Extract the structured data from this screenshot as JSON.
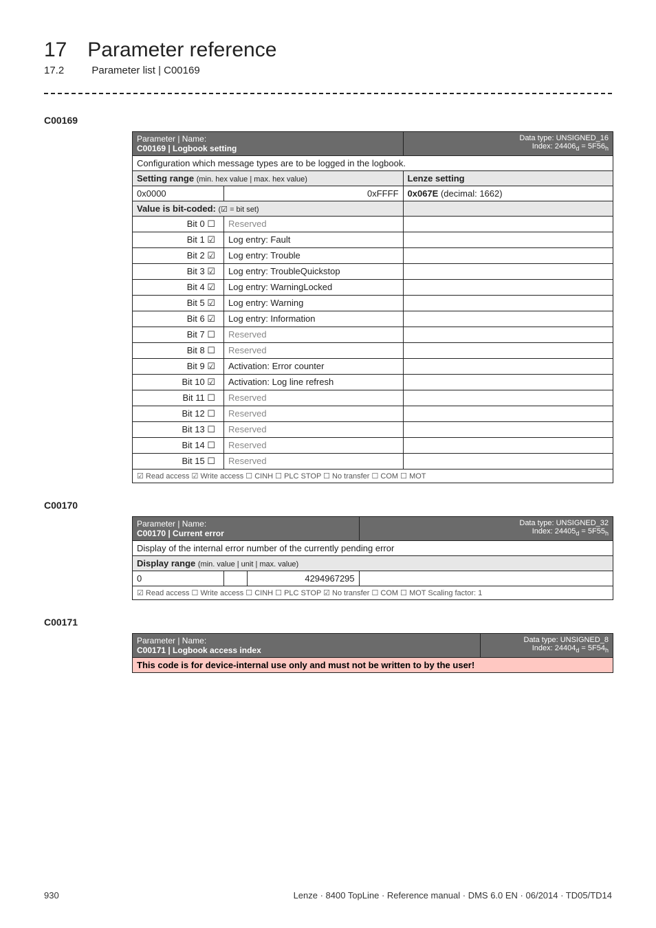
{
  "header": {
    "chapter_num": "17",
    "chapter_title": "Parameter reference",
    "section_num": "17.2",
    "section_title": "Parameter list | C00169"
  },
  "c00169": {
    "id": "C00169",
    "param_label": "Parameter | Name:",
    "name": "C00169 | Logbook setting",
    "dtype": "Data type: UNSIGNED_16",
    "index": "Index: 24406d = 5F56h",
    "config_desc": "Configuration which message types are to be logged in the logbook.",
    "setting_range_label": "Setting range",
    "setting_range_sub": "(min. hex value | max. hex value)",
    "lenze_label": "Lenze setting",
    "min": "0x0000",
    "max": "0xFFFF",
    "lenze_value": "0x067E",
    "lenze_decimal": "(decimal: 1662)",
    "bitset_label": "Value is bit-coded:",
    "bitset_sub": "(☑ = bit set)",
    "bits": [
      {
        "label": "Bit 0",
        "check": "☐",
        "text": "Reserved",
        "reserved": true
      },
      {
        "label": "Bit 1",
        "check": "☑",
        "text": "Log entry: Fault",
        "reserved": false
      },
      {
        "label": "Bit 2",
        "check": "☑",
        "text": "Log entry: Trouble",
        "reserved": false
      },
      {
        "label": "Bit 3",
        "check": "☑",
        "text": "Log entry: TroubleQuickstop",
        "reserved": false
      },
      {
        "label": "Bit 4",
        "check": "☑",
        "text": "Log entry: WarningLocked",
        "reserved": false
      },
      {
        "label": "Bit 5",
        "check": "☑",
        "text": "Log entry: Warning",
        "reserved": false
      },
      {
        "label": "Bit 6",
        "check": "☑",
        "text": "Log entry: Information",
        "reserved": false
      },
      {
        "label": "Bit 7",
        "check": "☐",
        "text": "Reserved",
        "reserved": true
      },
      {
        "label": "Bit 8",
        "check": "☐",
        "text": "Reserved",
        "reserved": true
      },
      {
        "label": "Bit 9",
        "check": "☑",
        "text": "Activation: Error counter",
        "reserved": false
      },
      {
        "label": "Bit 10",
        "check": "☑",
        "text": "Activation: Log line refresh",
        "reserved": false
      },
      {
        "label": "Bit 11",
        "check": "☐",
        "text": "Reserved",
        "reserved": true
      },
      {
        "label": "Bit 12",
        "check": "☐",
        "text": "Reserved",
        "reserved": true
      },
      {
        "label": "Bit 13",
        "check": "☐",
        "text": "Reserved",
        "reserved": true
      },
      {
        "label": "Bit 14",
        "check": "☐",
        "text": "Reserved",
        "reserved": true
      },
      {
        "label": "Bit 15",
        "check": "☐",
        "text": "Reserved",
        "reserved": true
      }
    ],
    "access": "☑ Read access  ☑ Write access  ☐ CINH  ☐ PLC STOP  ☐ No transfer  ☐ COM  ☐ MOT"
  },
  "c00170": {
    "id": "C00170",
    "param_label": "Parameter | Name:",
    "name": "C00170 | Current error",
    "dtype": "Data type: UNSIGNED_32",
    "index": "Index: 24405d = 5F55h",
    "desc": "Display of the internal error number of the currently pending error",
    "display_label": "Display range",
    "display_sub": "(min. value | unit | max. value)",
    "min": "0",
    "unit": "",
    "max": "4294967295",
    "access": "☑ Read access  ☐ Write access  ☐ CINH  ☐ PLC STOP  ☑ No transfer  ☐ COM  ☐ MOT   Scaling factor: 1"
  },
  "c00171": {
    "id": "C00171",
    "param_label": "Parameter | Name:",
    "name": "C00171 | Logbook access index",
    "dtype": "Data type: UNSIGNED_8",
    "index": "Index: 24404d = 5F54h",
    "warning": "This code is for device-internal use only and must not be written to by the user!"
  },
  "footer": {
    "page": "930",
    "meta": "Lenze · 8400 TopLine · Reference manual · DMS 6.0 EN · 06/2014 · TD05/TD14"
  }
}
